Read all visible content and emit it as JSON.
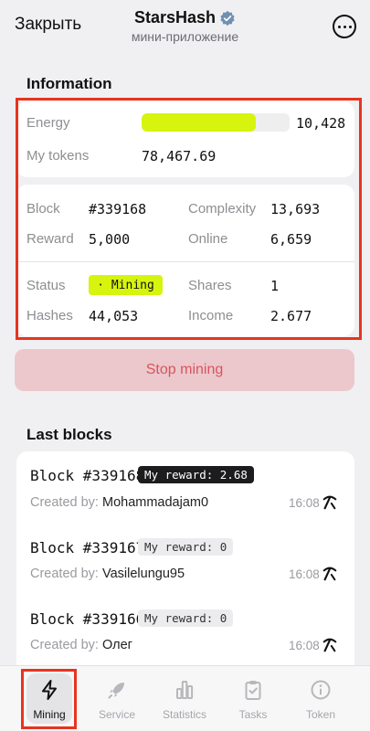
{
  "header": {
    "close_label": "Закрыть",
    "app_title": "StarsHash",
    "app_subtitle": "мини-приложение"
  },
  "information": {
    "section_title": "Information",
    "energy_label": "Energy",
    "energy_value": "10,428",
    "energy_fill_fraction": 0.77,
    "tokens_label": "My tokens",
    "tokens_value": "78,467.69",
    "block_label": "Block",
    "block_value": "#339168",
    "complexity_label": "Complexity",
    "complexity_value": "13,693",
    "reward_label": "Reward",
    "reward_value": "5,000",
    "online_label": "Online",
    "online_value": "6,659",
    "status_label": "Status",
    "status_value": "· Mining",
    "shares_label": "Shares",
    "shares_value": "1",
    "hashes_label": "Hashes",
    "hashes_value": "44,053",
    "income_label": "Income",
    "income_value": "2.677"
  },
  "stop_button_label": "Stop mining",
  "last_blocks": {
    "section_title": "Last blocks",
    "created_by_label": "Created by:",
    "items": [
      {
        "title": "Block #339168",
        "reward": "My reward: 2.68",
        "creator": "Mohammadajam0",
        "time": "16:08",
        "highlight": true
      },
      {
        "title": "Block #339167",
        "reward": "My reward: 0",
        "creator": "Vasilelungu95",
        "time": "16:08",
        "highlight": false
      },
      {
        "title": "Block #339166",
        "reward": "My reward: 0",
        "creator": "Олег",
        "time": "16:08",
        "highlight": false
      }
    ]
  },
  "nav": {
    "items": [
      {
        "label": "Mining",
        "icon": "bolt-icon"
      },
      {
        "label": "Service",
        "icon": "rocket-icon"
      },
      {
        "label": "Statistics",
        "icon": "bar-chart-icon"
      },
      {
        "label": "Tasks",
        "icon": "clipboard-check-icon"
      },
      {
        "label": "Token",
        "icon": "info-icon"
      }
    ]
  },
  "colors": {
    "accent_lime": "#d6f40e",
    "highlight_red": "#e8341f",
    "stop_bg": "#ecc8cc",
    "stop_text": "#d8545e"
  }
}
